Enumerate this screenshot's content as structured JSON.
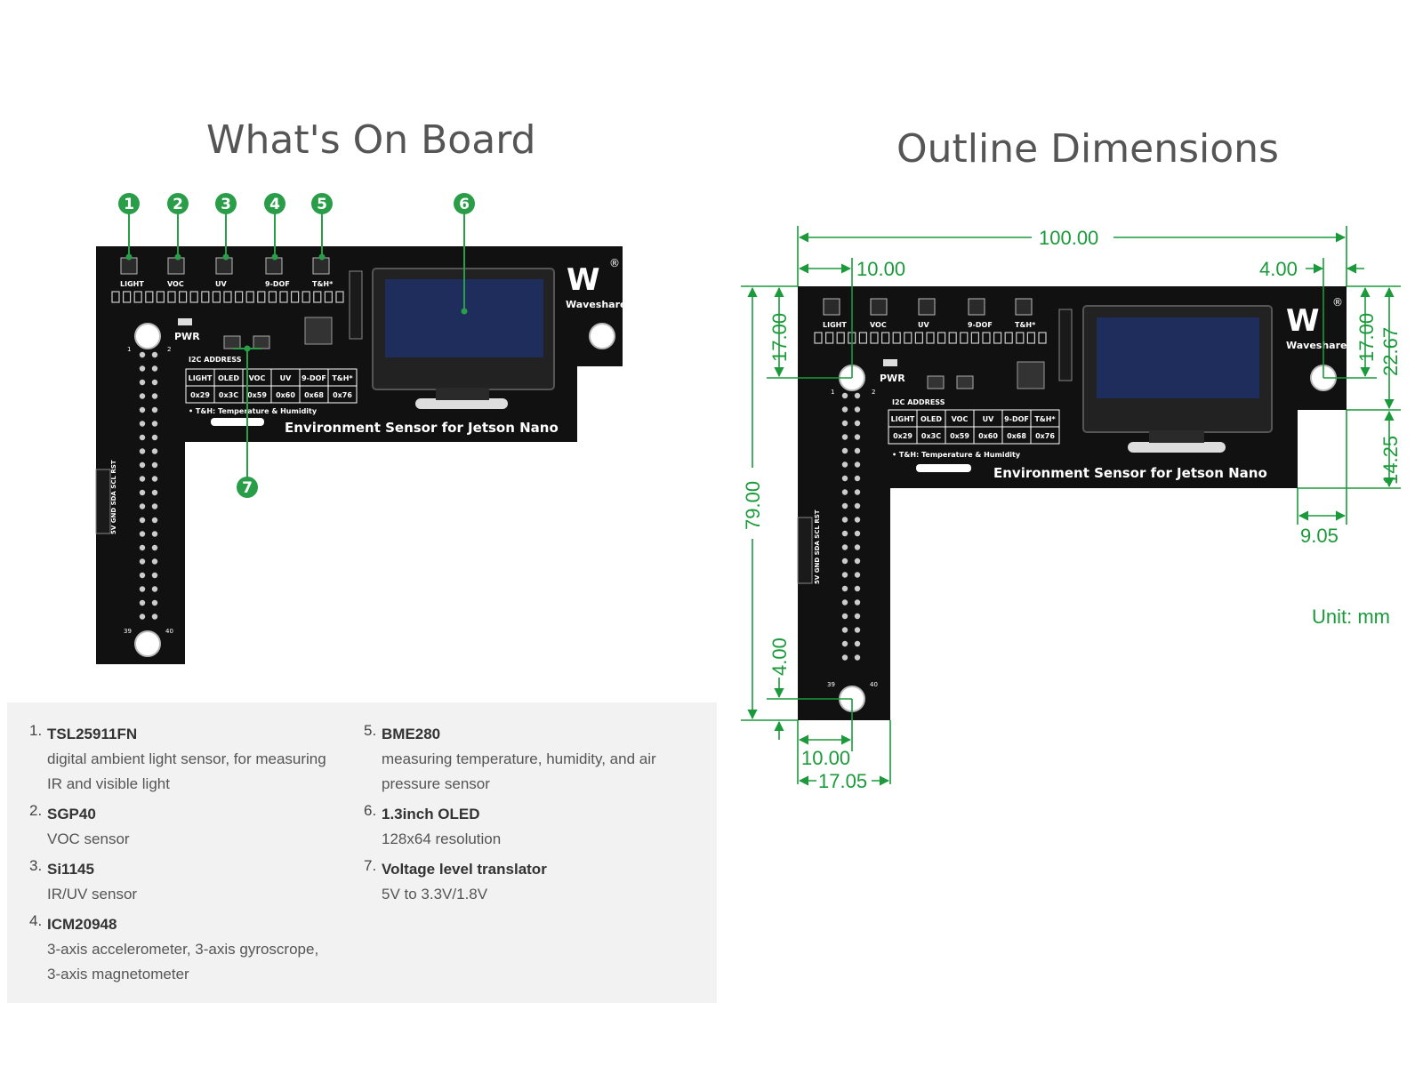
{
  "titles": {
    "left": "What's On Board",
    "right": "Outline Dimensions"
  },
  "colors": {
    "callout": "#2a9d48",
    "dimension": "#1a9a3a",
    "pcb": "#111111",
    "oled": "#1e2d5c",
    "panel": "#f2f2f2"
  },
  "board": {
    "sensor_labels": [
      "LIGHT",
      "VOC",
      "UV",
      "9-DOF",
      "T&H*"
    ],
    "pwr_label": "PWR",
    "brand": "Waveshare",
    "registered_mark": "®",
    "i2c_title": "I2C ADDRESS",
    "i2c_headers": [
      "LIGHT",
      "OLED",
      "VOC",
      "UV",
      "9-DOF",
      "T&H*"
    ],
    "i2c_values": [
      "0x29",
      "0x3C",
      "0x59",
      "0x60",
      "0x68",
      "0x76"
    ],
    "footnote": "• T&H: Temperature & Humidity",
    "product_name": "Environment Sensor for Jetson Nano",
    "side_pins": "5V GND SDA SCL RST",
    "pin_start": "1",
    "pin_start_b": "2",
    "pin_end": "39",
    "pin_end_b": "40"
  },
  "callouts": [
    "1",
    "2",
    "3",
    "4",
    "5",
    "6",
    "7"
  ],
  "dimensions": {
    "overall_width": "100.00",
    "left_offset": "10.00",
    "right_offset": "4.00",
    "top_height": "17.00",
    "right_top": "17.00",
    "right_total": "22.67",
    "right_lower": "14.25",
    "notch_width": "9.05",
    "total_height": "79.00",
    "bottom_offset": "4.00",
    "bottom_hole": "10.00",
    "bottom_width": "17.05",
    "unit": "Unit: mm"
  },
  "components": [
    {
      "number": "1.",
      "name": "TSL25911FN",
      "description": "digital ambient light sensor, for measuring\nIR and visible light"
    },
    {
      "number": "2.",
      "name": "SGP40",
      "description": "VOC sensor"
    },
    {
      "number": "3.",
      "name": "Si1145",
      "description": "IR/UV sensor"
    },
    {
      "number": "4.",
      "name": "ICM20948",
      "description": "3-axis accelerometer, 3-axis gyroscrope,\n3-axis magnetometer"
    },
    {
      "number": "5.",
      "name": "BME280",
      "description": "measuring temperature, humidity, and air\npressure sensor"
    },
    {
      "number": "6.",
      "name": "1.3inch OLED",
      "description": "128x64 resolution"
    },
    {
      "number": "7.",
      "name": "Voltage level translator",
      "description": "5V to 3.3V/1.8V"
    }
  ]
}
